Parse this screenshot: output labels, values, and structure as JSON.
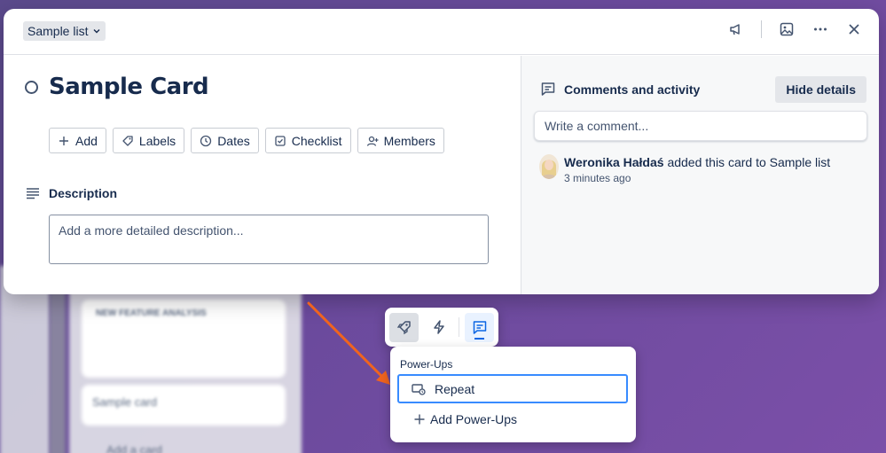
{
  "modal": {
    "list_name": "Sample list",
    "card_title": "Sample Card",
    "actions": [
      "Add",
      "Labels",
      "Dates",
      "Checklist",
      "Members"
    ],
    "description_label": "Description",
    "description_placeholder": "Add a more detailed description..."
  },
  "activity": {
    "title": "Comments and activity",
    "hide_details": "Hide details",
    "comment_placeholder": "Write a comment...",
    "user": "Weronika Hałdaś",
    "action_text": "added this card to Sample list",
    "time": "3 minutes ago"
  },
  "popover": {
    "title": "Power-Ups",
    "repeat": "Repeat",
    "add_powerups": "Add Power-Ups"
  },
  "background": {
    "list_label": "NEW FEATURE ANALYSIS",
    "card_label": "Sample card",
    "add_card": "Add a card"
  },
  "colors": {
    "accent": "#0c66e4",
    "focus_border": "#388bff",
    "arrow": "#f0641e"
  }
}
